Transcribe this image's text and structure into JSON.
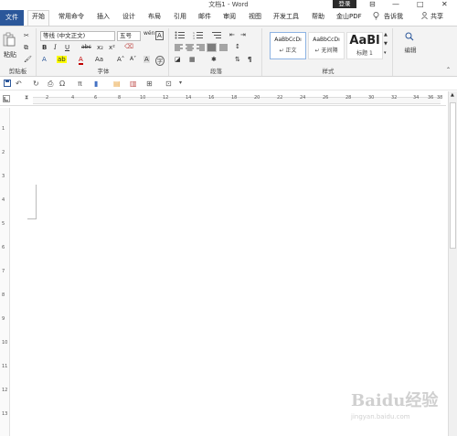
{
  "window": {
    "title": "文档1 - Word",
    "login": "登录",
    "controls": [
      "⊟",
      "—",
      "□",
      "✕"
    ]
  },
  "tabs": {
    "file": "文件",
    "items": [
      "开始",
      "常用命令",
      "插入",
      "设计",
      "布局",
      "引用",
      "邮件",
      "审阅",
      "视图",
      "开发工具",
      "帮助",
      "金山PDF"
    ],
    "tell_me": "告诉我",
    "share": "共享"
  },
  "ribbon": {
    "clipboard": {
      "label": "剪贴板",
      "paste": "粘贴"
    },
    "font": {
      "label": "字体",
      "font_name": "等线 (中文正文)",
      "font_size": "五号",
      "wen": "wén",
      "a_box": "A",
      "bold": "B",
      "italic": "I",
      "underline": "U",
      "strike": "abc",
      "sub": "x₂",
      "sup": "x²",
      "text_effect": "A",
      "highlight": "ab",
      "font_color": "A",
      "case": "Aa",
      "grow": "A˄",
      "shrink": "A˅",
      "clear": "A",
      "enclose": "字"
    },
    "paragraph": {
      "label": "段落"
    },
    "styles": {
      "label": "样式",
      "cards": [
        {
          "sample": "AaBbCcDı",
          "name": "↵ 正文"
        },
        {
          "sample": "AaBbCcDı",
          "name": "↵ 无间隔"
        },
        {
          "sample": "AaBl",
          "name": "标题 1"
        }
      ]
    },
    "editing": {
      "label": "编辑"
    }
  },
  "ruler": {
    "h_ticks": [
      "2",
      "4",
      "6",
      "8",
      "10",
      "12",
      "14",
      "16",
      "18",
      "20",
      "22",
      "24",
      "26",
      "28",
      "30",
      "32",
      "34",
      "36",
      "38"
    ],
    "v_ticks": [
      "1",
      "2",
      "3",
      "4",
      "5",
      "6",
      "7",
      "8",
      "9",
      "10",
      "11",
      "12",
      "13"
    ]
  },
  "watermark": {
    "text": "Baidu经验",
    "url": "jingyan.baidu.com"
  }
}
